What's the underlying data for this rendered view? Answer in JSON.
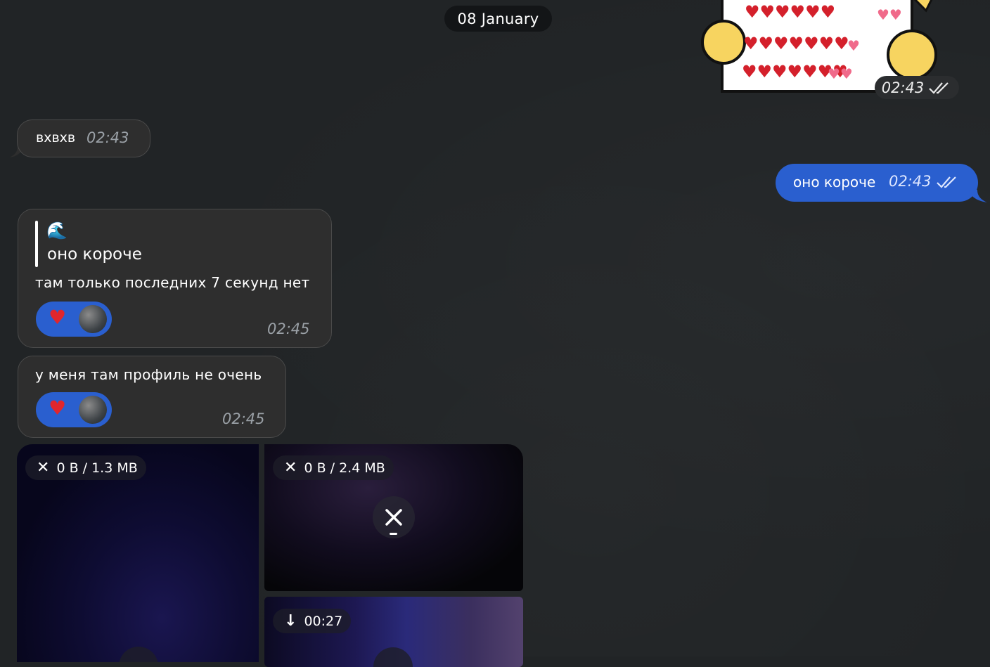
{
  "date_separator": "08 January",
  "messages": [
    {
      "id": "sticker",
      "direction": "out",
      "time": "02:43",
      "read": true
    },
    {
      "id": "m1",
      "direction": "in",
      "text": "вхвхв",
      "time": "02:43"
    },
    {
      "id": "m2",
      "direction": "out",
      "text": "оно короче",
      "time": "02:43",
      "read": true
    },
    {
      "id": "m3",
      "direction": "in",
      "reply": {
        "emoji": "🌊",
        "text": "оно короче"
      },
      "text": "там только последних 7 секунд нет",
      "reaction": "❤️",
      "time": "02:45"
    },
    {
      "id": "m4",
      "direction": "in",
      "text": "у меня там профиль не очень",
      "reaction": "❤️",
      "time": "02:45"
    }
  ],
  "media": [
    {
      "label": "0 B / 1.3 MB"
    },
    {
      "label": "0 B / 2.4 MB"
    },
    {
      "label": "00:27"
    }
  ],
  "colors": {
    "background": "#212426",
    "outgoing": "#2a5fcf",
    "incoming": "#2e2e2e",
    "reaction": "#2a5fcf"
  }
}
